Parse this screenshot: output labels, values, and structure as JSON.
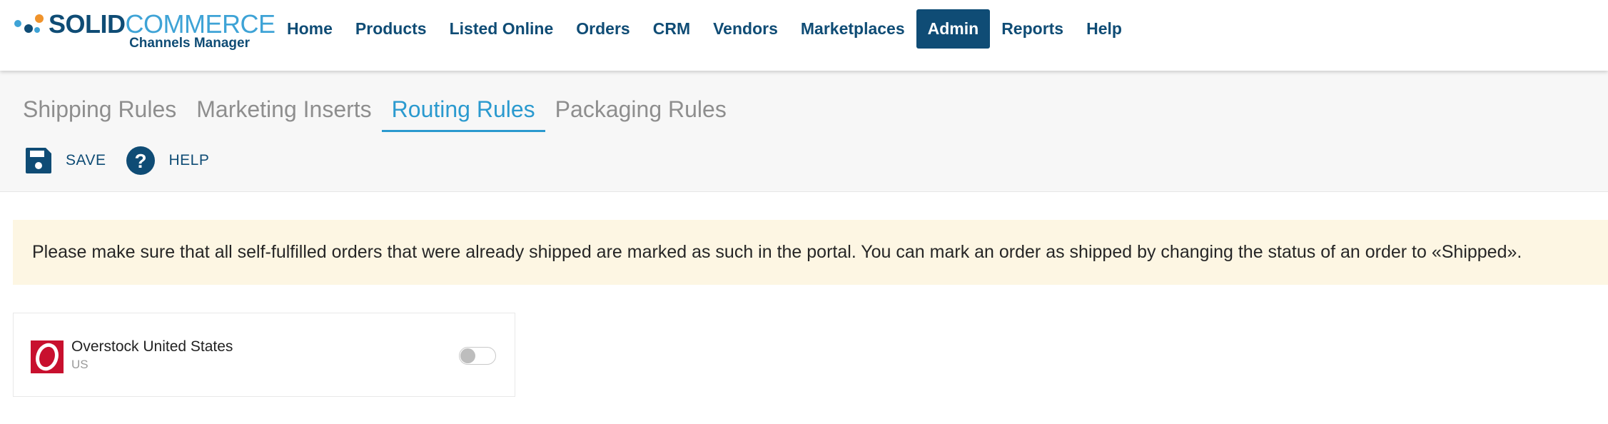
{
  "brand": {
    "name_part1": "SOLID",
    "name_part2": "COMMERCE",
    "subtitle": "Channels Manager"
  },
  "nav": {
    "items": [
      {
        "label": "Home",
        "active": false
      },
      {
        "label": "Products",
        "active": false
      },
      {
        "label": "Listed Online",
        "active": false
      },
      {
        "label": "Orders",
        "active": false
      },
      {
        "label": "CRM",
        "active": false
      },
      {
        "label": "Vendors",
        "active": false
      },
      {
        "label": "Marketplaces",
        "active": false
      },
      {
        "label": "Admin",
        "active": true
      },
      {
        "label": "Reports",
        "active": false
      },
      {
        "label": "Help",
        "active": false
      }
    ]
  },
  "tabs": [
    {
      "label": "Shipping Rules",
      "active": false
    },
    {
      "label": "Marketing Inserts",
      "active": false
    },
    {
      "label": "Routing Rules",
      "active": true
    },
    {
      "label": "Packaging Rules",
      "active": false
    }
  ],
  "toolbar": {
    "save_label": "SAVE",
    "save_icon": "save-icon",
    "help_label": "HELP",
    "help_icon": "help-icon"
  },
  "alert": {
    "text": "Please make sure that all self-fulfilled orders that were already shipped are marked as such in the portal. You can mark an order as shipped by changing the status of an order to «Shipped»."
  },
  "channel": {
    "name": "Overstock United States",
    "country": "US",
    "logo_letter": "O",
    "enabled": false
  },
  "colors": {
    "primary": "#0f4c75",
    "accent": "#2b9acf",
    "alert_bg": "#fdf6e3",
    "overstock_red": "#c8102e"
  }
}
